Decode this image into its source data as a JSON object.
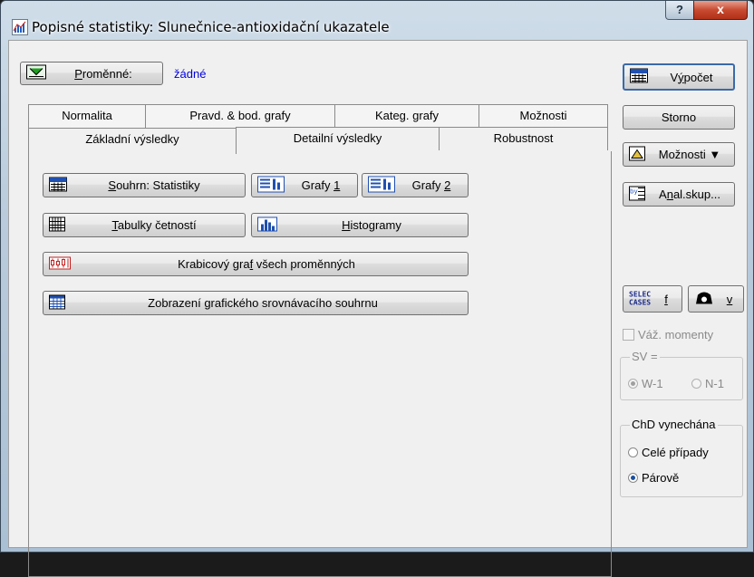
{
  "window": {
    "title": "Popisné statistiky: Slunečnice-antioxidační ukazatele",
    "help_glyph": "?",
    "close_glyph": "x"
  },
  "variables": {
    "button_label": "Proměnné:",
    "button_underline": "P",
    "value": "žádné"
  },
  "tabs_back": [
    "Normalita",
    "Pravd. & bod. grafy",
    "Kateg. grafy",
    "Možnosti"
  ],
  "tabs_front": [
    "Základní výsledky",
    "Detailní výsledky",
    "Robustnost"
  ],
  "buttons": {
    "summary_stats": {
      "underline": "S",
      "rest": "ouhrn: Statistiky"
    },
    "graphs1": {
      "pre": "Grafy ",
      "underline": "1"
    },
    "graphs2": {
      "pre": "Grafy ",
      "underline": "2"
    },
    "frequency_tables": {
      "underline": "T",
      "rest": "abulky četností"
    },
    "histograms": {
      "underline": "H",
      "rest": "istogramy"
    },
    "box_plot": {
      "pre": "Krabicový gra",
      "underline": "f",
      "rest": " všech proměnných"
    },
    "comparison_summary": "Zobrazení grafického srovnávacího souhrnu"
  },
  "side": {
    "compute": {
      "pre": "V",
      "underline": "ý",
      "rest": "počet"
    },
    "cancel": "Storno",
    "options": "Možnosti",
    "byg": {
      "pre": "A",
      "underline": "n",
      "rest": "al.skup..."
    },
    "select_f": "f",
    "weight_v": "v",
    "weighted_moments": "Váž. momenty",
    "sv_group": {
      "title": "SV =",
      "w1": "W-1",
      "n1": "N-1"
    },
    "md_group": {
      "title": "ChD vynechána",
      "casewise": "Celé případy",
      "pairwise": "Párově"
    }
  }
}
